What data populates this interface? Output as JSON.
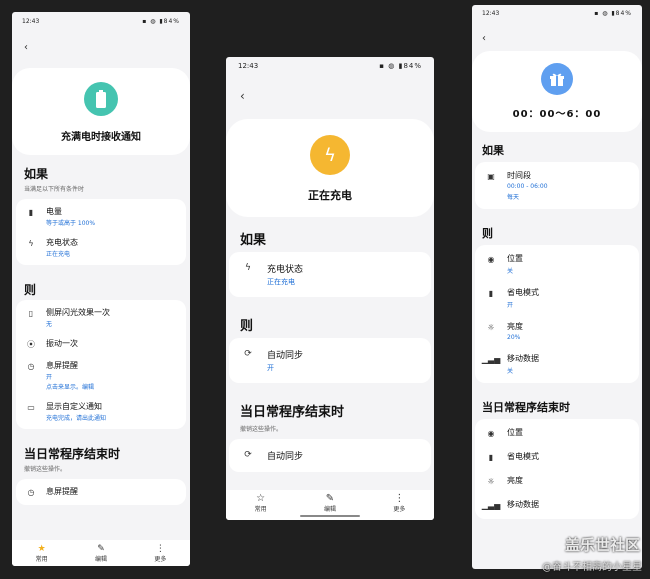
{
  "phone1": {
    "status": {
      "time": "12:43",
      "battery": "84%"
    },
    "hero_title": "充满电时接收通知",
    "if_section": {
      "title": "如果",
      "subtitle": "当满足以下所有条件时"
    },
    "conditions": [
      {
        "icon": "battery-icon",
        "label": "电量",
        "value": "等于或高于 100%"
      },
      {
        "icon": "bolt-icon",
        "label": "充电状态",
        "value": "正在充电"
      }
    ],
    "then_section": {
      "title": "则"
    },
    "actions": [
      {
        "icon": "edge-flash-icon",
        "label": "侧屏闪光效果一次",
        "value": "无"
      },
      {
        "icon": "vibrate-icon",
        "label": "振动一次",
        "value": ""
      },
      {
        "icon": "aod-icon",
        "label": "息屏提醒",
        "value": "开",
        "value2": "点击来显示。编辑"
      },
      {
        "icon": "notification-icon",
        "label": "显示自定义通知",
        "value": "充电完成，请出此通知"
      }
    ],
    "end_section": {
      "title": "当日常程序结束时",
      "subtitle": "撤销这些操作。"
    },
    "end_actions": [
      {
        "icon": "aod-icon",
        "label": "息屏提醒"
      }
    ],
    "nav": [
      {
        "icon": "star-icon",
        "label": "常用"
      },
      {
        "icon": "pencil-icon",
        "label": "编辑"
      },
      {
        "icon": "more-icon",
        "label": "更多"
      }
    ]
  },
  "phone2": {
    "status": {
      "time": "12:43",
      "battery": "84%"
    },
    "hero_title": "正在充电",
    "if_section": {
      "title": "如果"
    },
    "conditions": [
      {
        "icon": "bolt-icon",
        "label": "充电状态",
        "value": "正在充电"
      }
    ],
    "then_section": {
      "title": "则"
    },
    "actions": [
      {
        "icon": "sync-icon",
        "label": "自动同步",
        "value": "开"
      }
    ],
    "end_section": {
      "title": "当日常程序结束时",
      "subtitle": "撤销这些操作。"
    },
    "end_actions": [
      {
        "icon": "sync-icon",
        "label": "自动同步"
      }
    ],
    "nav": [
      {
        "icon": "star-icon",
        "label": "常用"
      },
      {
        "icon": "pencil-icon",
        "label": "编辑"
      },
      {
        "icon": "more-icon",
        "label": "更多"
      }
    ]
  },
  "phone3": {
    "status": {
      "time": "12:43",
      "battery": "84%"
    },
    "hero_title": "00：00～6：00",
    "if_section": {
      "title": "如果"
    },
    "conditions": [
      {
        "icon": "calendar-icon",
        "label": "时间段",
        "value": "00:00 - 06:00",
        "value2": "每天"
      }
    ],
    "then_section": {
      "title": "则"
    },
    "actions": [
      {
        "icon": "location-icon",
        "label": "位置",
        "value": "关"
      },
      {
        "icon": "power-saving-icon",
        "label": "省电模式",
        "value": "开"
      },
      {
        "icon": "brightness-icon",
        "label": "亮度",
        "value": "20%"
      },
      {
        "icon": "mobile-data-icon",
        "label": "移动数据",
        "value": "关"
      }
    ],
    "end_section": {
      "title": "当日常程序结束时"
    },
    "end_actions": [
      {
        "icon": "location-icon",
        "label": "位置"
      },
      {
        "icon": "power-saving-icon",
        "label": "省电模式"
      },
      {
        "icon": "brightness-icon",
        "label": "亮度"
      },
      {
        "icon": "mobile-data-icon",
        "label": "移动数据"
      }
    ]
  },
  "watermark": {
    "line1": "盖乐世社区",
    "line2": "@奋斗不相离的小星星"
  },
  "colors": {
    "teal": "#45c4b0",
    "amber": "#f5b731",
    "blue": "#5f9ff0",
    "link": "#1f6fd6"
  }
}
